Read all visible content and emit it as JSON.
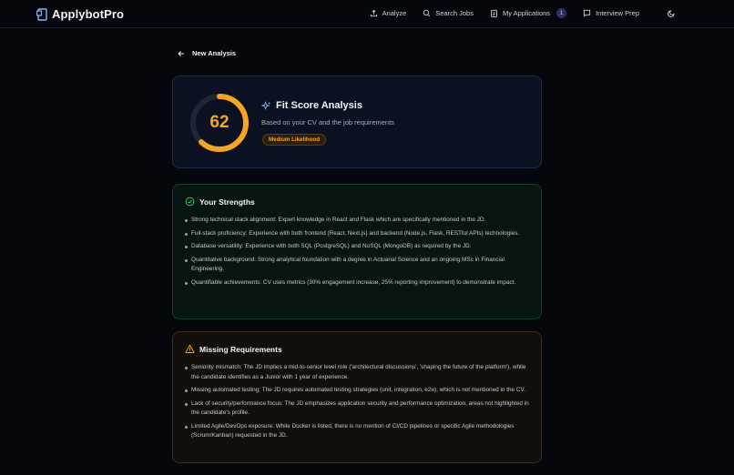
{
  "app": {
    "name": "ApplybotPro"
  },
  "nav": {
    "items": [
      {
        "label": "Analyze",
        "icon": "upload-icon"
      },
      {
        "label": "Search Jobs",
        "icon": "search-icon"
      },
      {
        "label": "My Applications",
        "icon": "clipboard-icon",
        "badge": "1"
      },
      {
        "label": "Interview Prep",
        "icon": "chat-icon"
      }
    ],
    "theme_icon": "moon-icon"
  },
  "back": {
    "label": "New Analysis"
  },
  "fit_score": {
    "score": "62",
    "score_fraction": 0.62,
    "title": "Fit Score Analysis",
    "subtitle": "Based on your CV and the job requirements",
    "likelihood": "Medium Likelihood",
    "accent": "#f5a524"
  },
  "strengths": {
    "title": "Your Strengths",
    "accent": "#22c55e",
    "items": [
      "Strong technical stack alignment: Expert knowledge in React and Flask which are specifically mentioned in the JD.",
      "Full-stack proficiency: Experience with both frontend (React, Next.js) and backend (Node.js, Flask, RESTful APIs) technologies.",
      "Database versatility: Experience with both SQL (PostgreSQL) and NoSQL (MongoDB) as required by the JD.",
      "Quantitative background: Strong analytical foundation with a degree in Actuarial Science and an ongoing MSc in Financial Engineering.",
      "Quantifiable achievements: CV uses metrics (30% engagement increase, 25% reporting improvement) to demonstrate impact."
    ]
  },
  "missing": {
    "title": "Missing Requirements",
    "accent": "#f59e0b",
    "items": [
      "Seniority mismatch: The JD implies a mid-to-senior level role ('architectural discussions', 'shaping the future of the platform'), while the candidate identifies as a Junior with 1 year of experience.",
      "Missing automated testing: The JD requires automated testing strategies (unit, integration, e2e), which is not mentioned in the CV.",
      "Lack of security/performance focus: The JD emphasizes application security and performance optimization, areas not highlighted in the candidate's profile.",
      "Limited Agile/DevOps exposure: While Docker is listed, there is no mention of CI/CD pipelines or specific Agile methodologies (Scrum/Kanban) requested in the JD."
    ]
  }
}
